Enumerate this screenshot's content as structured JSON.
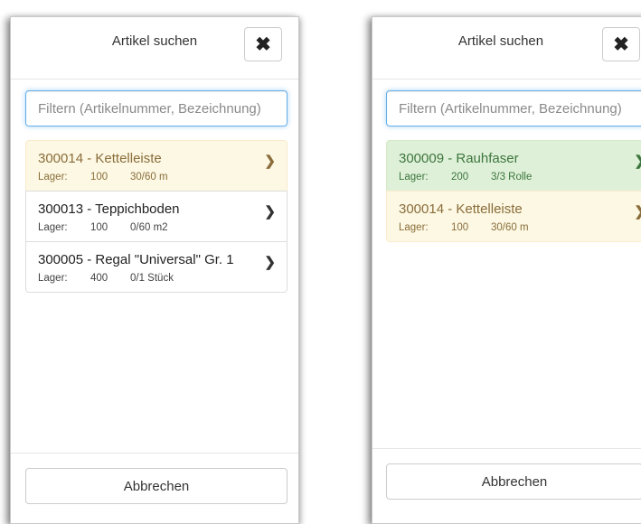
{
  "dialogs": [
    {
      "title": "Artikel suchen",
      "close_icon": "times-icon",
      "filter_placeholder": "Filtern (Artikelnummer, Bezeichnung)",
      "filter_value": "",
      "items": [
        {
          "title": "300014 - Kettelleiste",
          "lager_label": "Lager:",
          "lager": "100",
          "stock": "30/60 m",
          "state": "warning"
        },
        {
          "title": "300013 - Teppichboden",
          "lager_label": "Lager:",
          "lager": "100",
          "stock": "0/60 m2",
          "state": "default"
        },
        {
          "title": "300005 - Regal \"Universal\" Gr. 1",
          "lager_label": "Lager:",
          "lager": "400",
          "stock": "0/1 Stück",
          "state": "default"
        }
      ],
      "cancel_label": "Abbrechen"
    },
    {
      "title": "Artikel suchen",
      "close_icon": "times-icon",
      "filter_placeholder": "Filtern (Artikelnummer, Bezeichnung)",
      "filter_value": "",
      "items": [
        {
          "title": "300009 - Rauhfaser",
          "lager_label": "Lager:",
          "lager": "200",
          "stock": "3/3 Rolle",
          "state": "success"
        },
        {
          "title": "300014 - Kettelleiste",
          "lager_label": "Lager:",
          "lager": "100",
          "stock": "30/60 m",
          "state": "warning"
        }
      ],
      "cancel_label": "Abbrechen"
    }
  ],
  "icons": {
    "close": "✖",
    "chevron": "❯"
  },
  "colors": {
    "warning_bg": "#fcf8e3",
    "warning_text": "#8a6d3b",
    "success_bg": "#dff0d8",
    "success_text": "#3c763d",
    "focus_border": "#66afe9"
  }
}
